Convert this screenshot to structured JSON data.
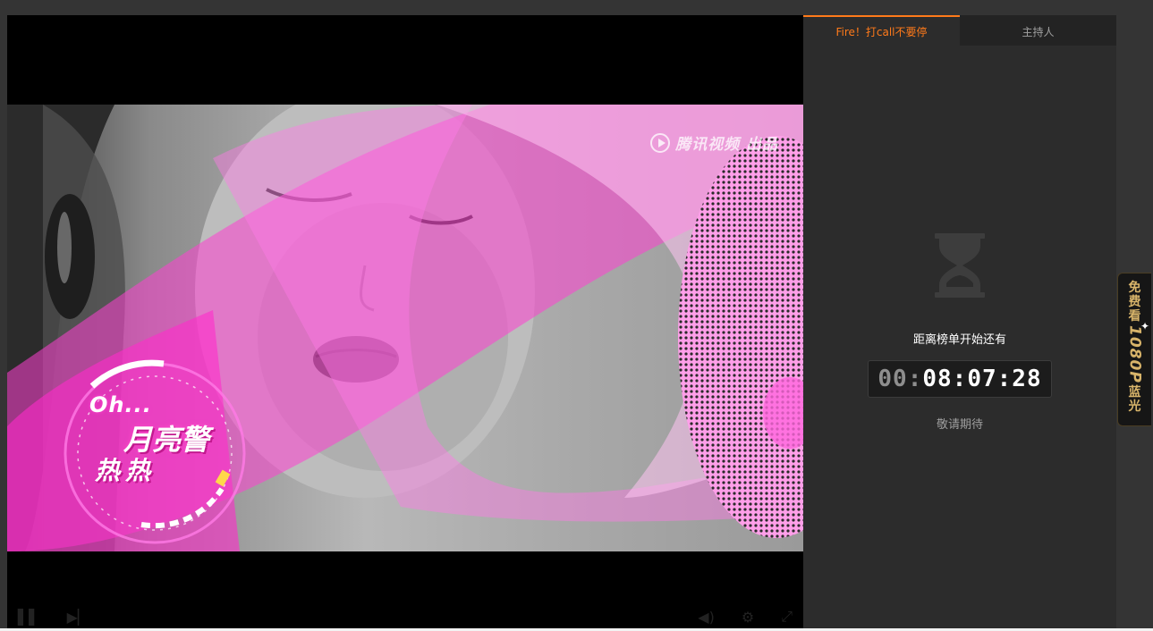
{
  "video": {
    "watermark": "腾讯视频 出品",
    "caption_oh": "Oh...",
    "caption_main": "月亮警",
    "caption_sub": "热热"
  },
  "tabs": [
    {
      "label": "Fire！打call不要停",
      "active": true
    },
    {
      "label": "主持人",
      "active": false
    }
  ],
  "countdown": {
    "label": "距离榜单开始还有",
    "hours": "00",
    "sep1": ":",
    "minutes": "08",
    "sep2": ":",
    "seconds": "07",
    "sep3": ":",
    "frames": "28",
    "footer": "敬请期待"
  },
  "promo": {
    "line1": "免费看",
    "resolution": "1080P",
    "line2": "蓝光"
  },
  "colors": {
    "accent": "#ff7a1a",
    "gold": "#d8b46a",
    "panel": "#2c2c2c",
    "magenta": "#ff3fd2"
  },
  "icons": {
    "hourglass": "hourglass-icon",
    "watermark": "tencent-video-logo-icon"
  }
}
